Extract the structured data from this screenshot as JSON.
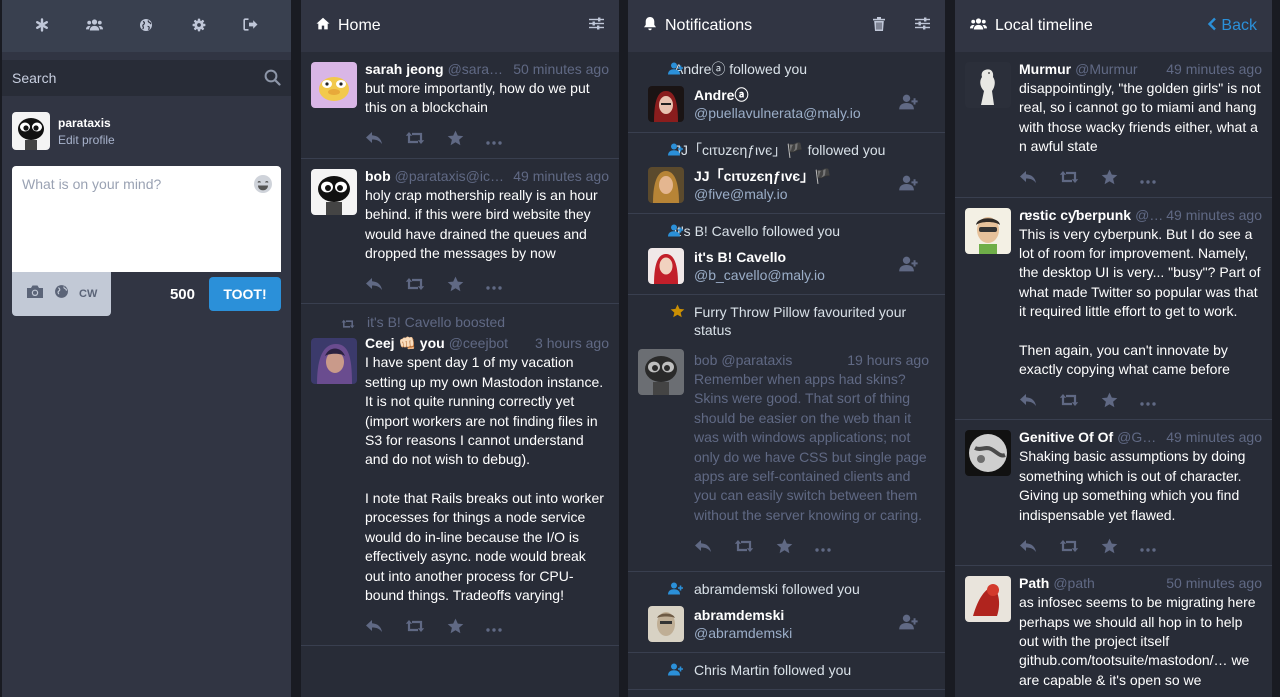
{
  "drawer": {
    "tabs": [
      {
        "name": "getting-started",
        "icon": "asterisk-icon"
      },
      {
        "name": "local-timeline",
        "icon": "users-icon"
      },
      {
        "name": "federated-timeline",
        "icon": "globe-icon"
      },
      {
        "name": "preferences",
        "icon": "gear-icon"
      },
      {
        "name": "logout",
        "icon": "sign-out-icon"
      }
    ],
    "search_placeholder": "Search",
    "me": {
      "username": "parataxis",
      "edit_label": "Edit profile"
    },
    "compose": {
      "placeholder": "What is on your mind?",
      "cw_label": "CW",
      "counter": "500",
      "toot_label": "TOOT!"
    }
  },
  "home": {
    "title": "Home",
    "statuses": [
      {
        "name": "sarah jeong",
        "handle": "@sarah…",
        "time": "50 minutes ago",
        "paragraphs": [
          "but more importantly, how do we put this on a blockchain"
        ]
      },
      {
        "name": "bob",
        "handle": "@parataxis@ico…",
        "time": "49 minutes ago",
        "paragraphs": [
          "holy crap mothership really is an hour behind. if this were bird website they would have drained the queues and dropped the messages by now"
        ]
      },
      {
        "boosted_by": "it's B! Cavello boosted",
        "name": "Ceej 👊🏻 you",
        "handle": "@ceejbot",
        "time": "3 hours ago",
        "paragraphs": [
          "I have spent day 1 of my vacation setting up my own Mastodon instance. It is not quite running correctly yet (import workers are not finding files in S3 for reasons I cannot understand and do not wish to debug).",
          "I note that Rails breaks out into worker processes for things a node service would do in-line because the I/O is effectively async. node would break out into another process for CPU-bound things. Tradeoffs varying!"
        ]
      }
    ]
  },
  "notifications": {
    "title": "Notifications",
    "items": [
      {
        "type": "follow",
        "text": "Andreⓐ followed you",
        "name": "Andreⓐ",
        "acct": "@puellavulnerata@maly.io"
      },
      {
        "type": "follow",
        "text": "JJ「cιτυzєηƒιvє」🏴 followed you",
        "name": "JJ「cιτυzєηƒιvє」🏴",
        "acct": "@five@maly.io"
      },
      {
        "type": "follow",
        "text": "it's B! Cavello followed you",
        "name": "it's B! Cavello",
        "acct": "@b_cavello@maly.io"
      }
    ],
    "favourite": {
      "text": "Furry Throw Pillow favourited your status",
      "name": "bob",
      "handle": "@parataxis",
      "time": "19 hours ago",
      "body": "Remember when apps had skins? Skins were good. That sort of thing should be easier on the web than it was with windows applications; not only do we have CSS but single page apps are self-contained clients and you can easily switch between them without the server knowing or caring."
    },
    "items2": [
      {
        "type": "follow",
        "text": "abramdemski followed you",
        "name": "abramdemski",
        "acct": "@abramdemski"
      },
      {
        "type": "follow",
        "text": "Chris Martin followed you"
      }
    ]
  },
  "local": {
    "title": "Local timeline",
    "back_label": "Back",
    "statuses": [
      {
        "name": "Murmur",
        "handle": "@Murmur",
        "time": "49 minutes ago",
        "paragraphs": [
          "disappointingly, \"the golden girls\" is not real, so i cannot go to miami and hang with those wacky friends either, what a n awful state"
        ]
      },
      {
        "name": "ɾɐstic cƴberpunk",
        "handle": "@c…",
        "time": "49 minutes ago",
        "paragraphs": [
          "This is very cyberpunk. But I do see a lot of room for improvement. Namely, the desktop UI is very... \"busy\"? Part of what made Twitter so popular was that it required little effort to get to work.",
          "Then again, you can't innovate by exactly copying what came before"
        ]
      },
      {
        "name": "Genitive Of Of",
        "handle": "@Ge…",
        "time": "49 minutes ago",
        "paragraphs": [
          "Shaking basic assumptions by doing something which is out of character. Giving up something which you find indispensable yet flawed."
        ]
      },
      {
        "name": "Path",
        "handle": "@path",
        "time": "50 minutes ago",
        "paragraphs": [
          "as infosec seems to be migrating here perhaps we should all hop in to help out with the project itself github.com/tootsuite/mastodon/… we are capable & it's open so we"
        ]
      }
    ]
  },
  "colors": {
    "bg": "#191b22",
    "column": "#282c37",
    "header": "#313543",
    "accent": "#2b90d9",
    "muted": "#606984",
    "fav": "#ca8f04"
  }
}
